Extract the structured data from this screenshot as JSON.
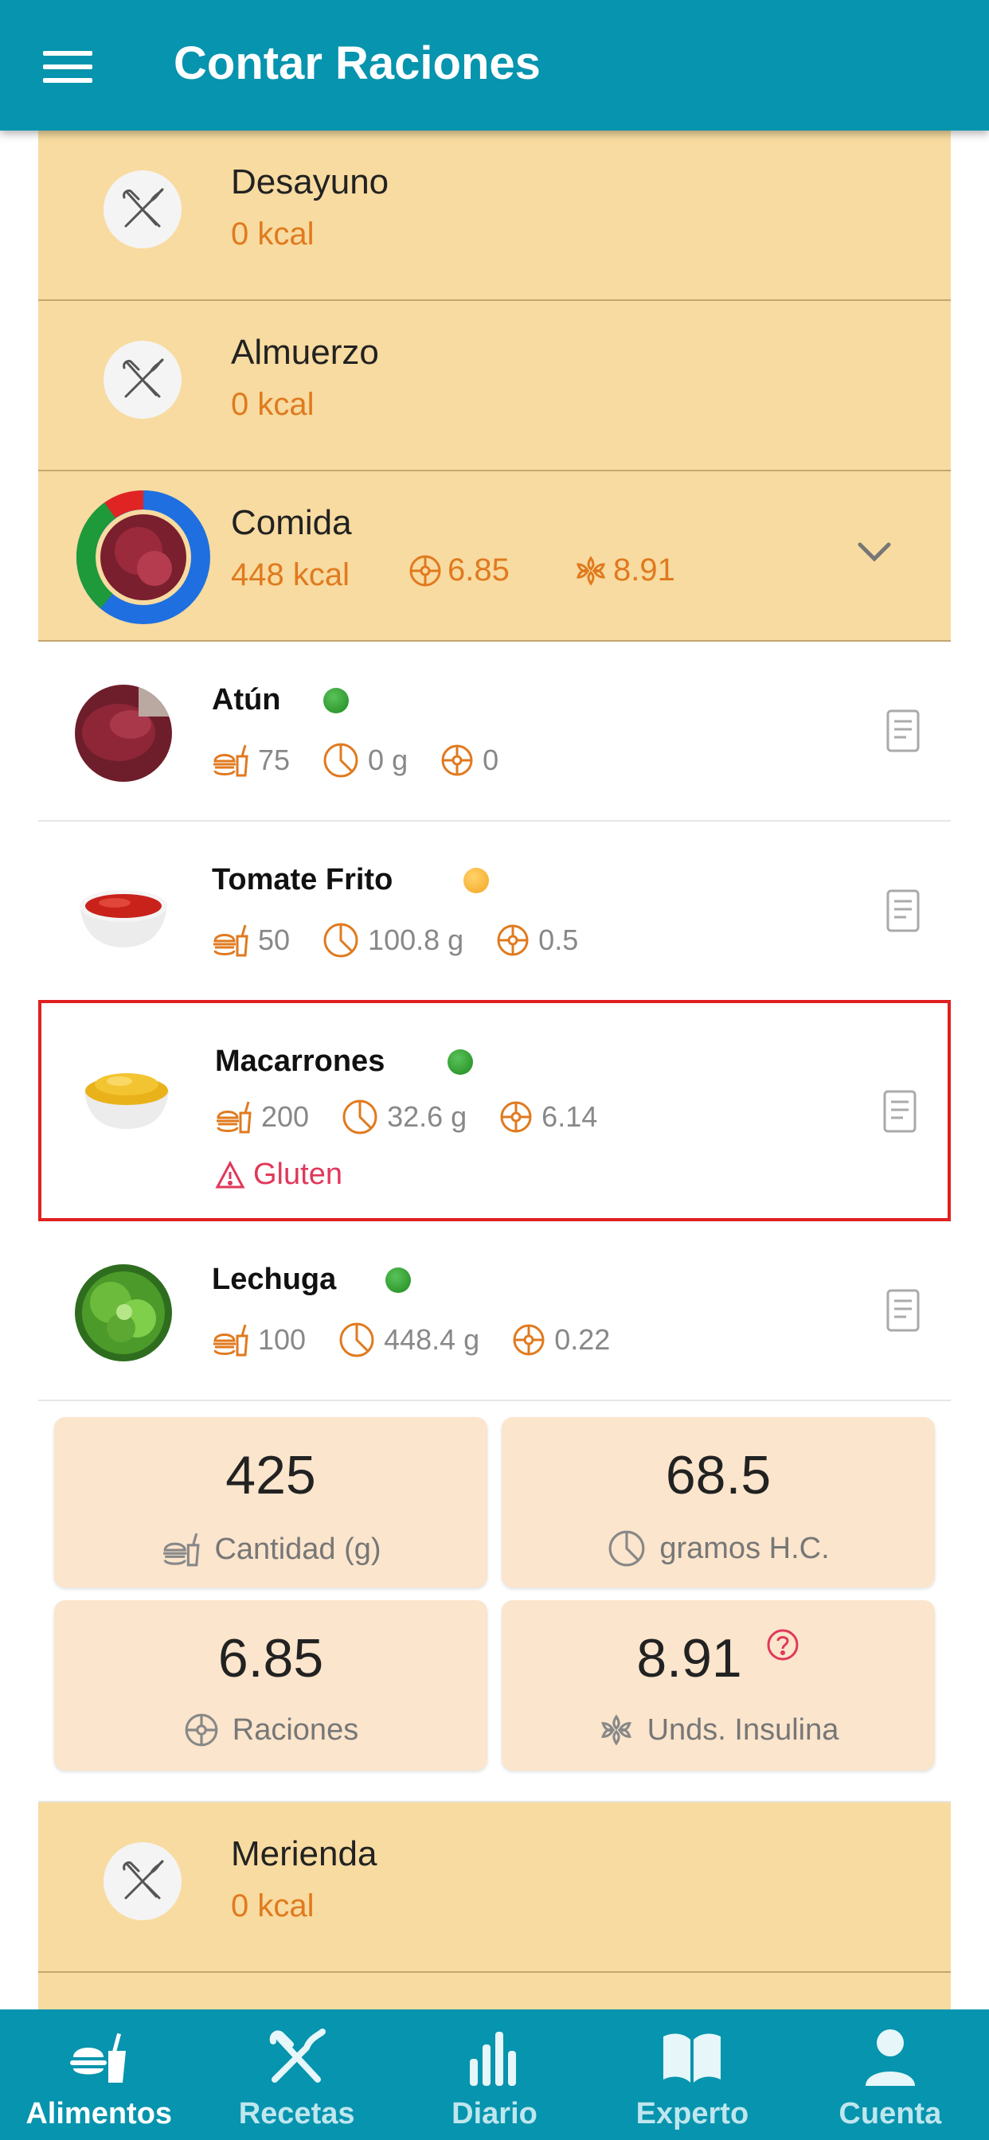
{
  "app": {
    "title": "Contar Raciones"
  },
  "meals": [
    {
      "name": "Desayuno",
      "kcal": "0 kcal"
    },
    {
      "name": "Almuerzo",
      "kcal": "0 kcal"
    },
    {
      "name": "Comida",
      "kcal": "448 kcal",
      "raciones": "6.85",
      "insulina": "8.91"
    },
    {
      "name": "Merienda",
      "kcal": "0 kcal"
    }
  ],
  "foods": [
    {
      "name": "Atún",
      "status": "green",
      "cantidad": "75",
      "hc": "0 g",
      "raciones": "0"
    },
    {
      "name": "Tomate Frito",
      "status": "orange",
      "cantidad": "50",
      "hc": "100.8 g",
      "raciones": "0.5"
    },
    {
      "name": "Macarrones",
      "status": "green",
      "cantidad": "200",
      "hc": "32.6 g",
      "raciones": "6.14",
      "warning": "Gluten"
    },
    {
      "name": "Lechuga",
      "status": "green",
      "cantidad": "100",
      "hc": "448.4 g",
      "raciones": "0.22"
    }
  ],
  "summary": {
    "cantidad": {
      "value": "425",
      "label": "Cantidad (g)"
    },
    "hc": {
      "value": "68.5",
      "label": "gramos H.C."
    },
    "raciones": {
      "value": "6.85",
      "label": "Raciones"
    },
    "insulina": {
      "value": "8.91",
      "label": "Unds. Insulina"
    }
  },
  "nav": [
    {
      "label": "Alimentos",
      "icon": "food-icon",
      "active": true
    },
    {
      "label": "Recetas",
      "icon": "utensils-icon"
    },
    {
      "label": "Diario",
      "icon": "bar-chart-icon"
    },
    {
      "label": "Experto",
      "icon": "book-icon"
    },
    {
      "label": "Cuenta",
      "icon": "person-icon"
    }
  ],
  "colors": {
    "primary": "#0694ae",
    "meal_bg": "#f8dba0",
    "accent": "#e07a1f",
    "warning": "#e0385a",
    "card_bg": "#fbe5cc"
  }
}
